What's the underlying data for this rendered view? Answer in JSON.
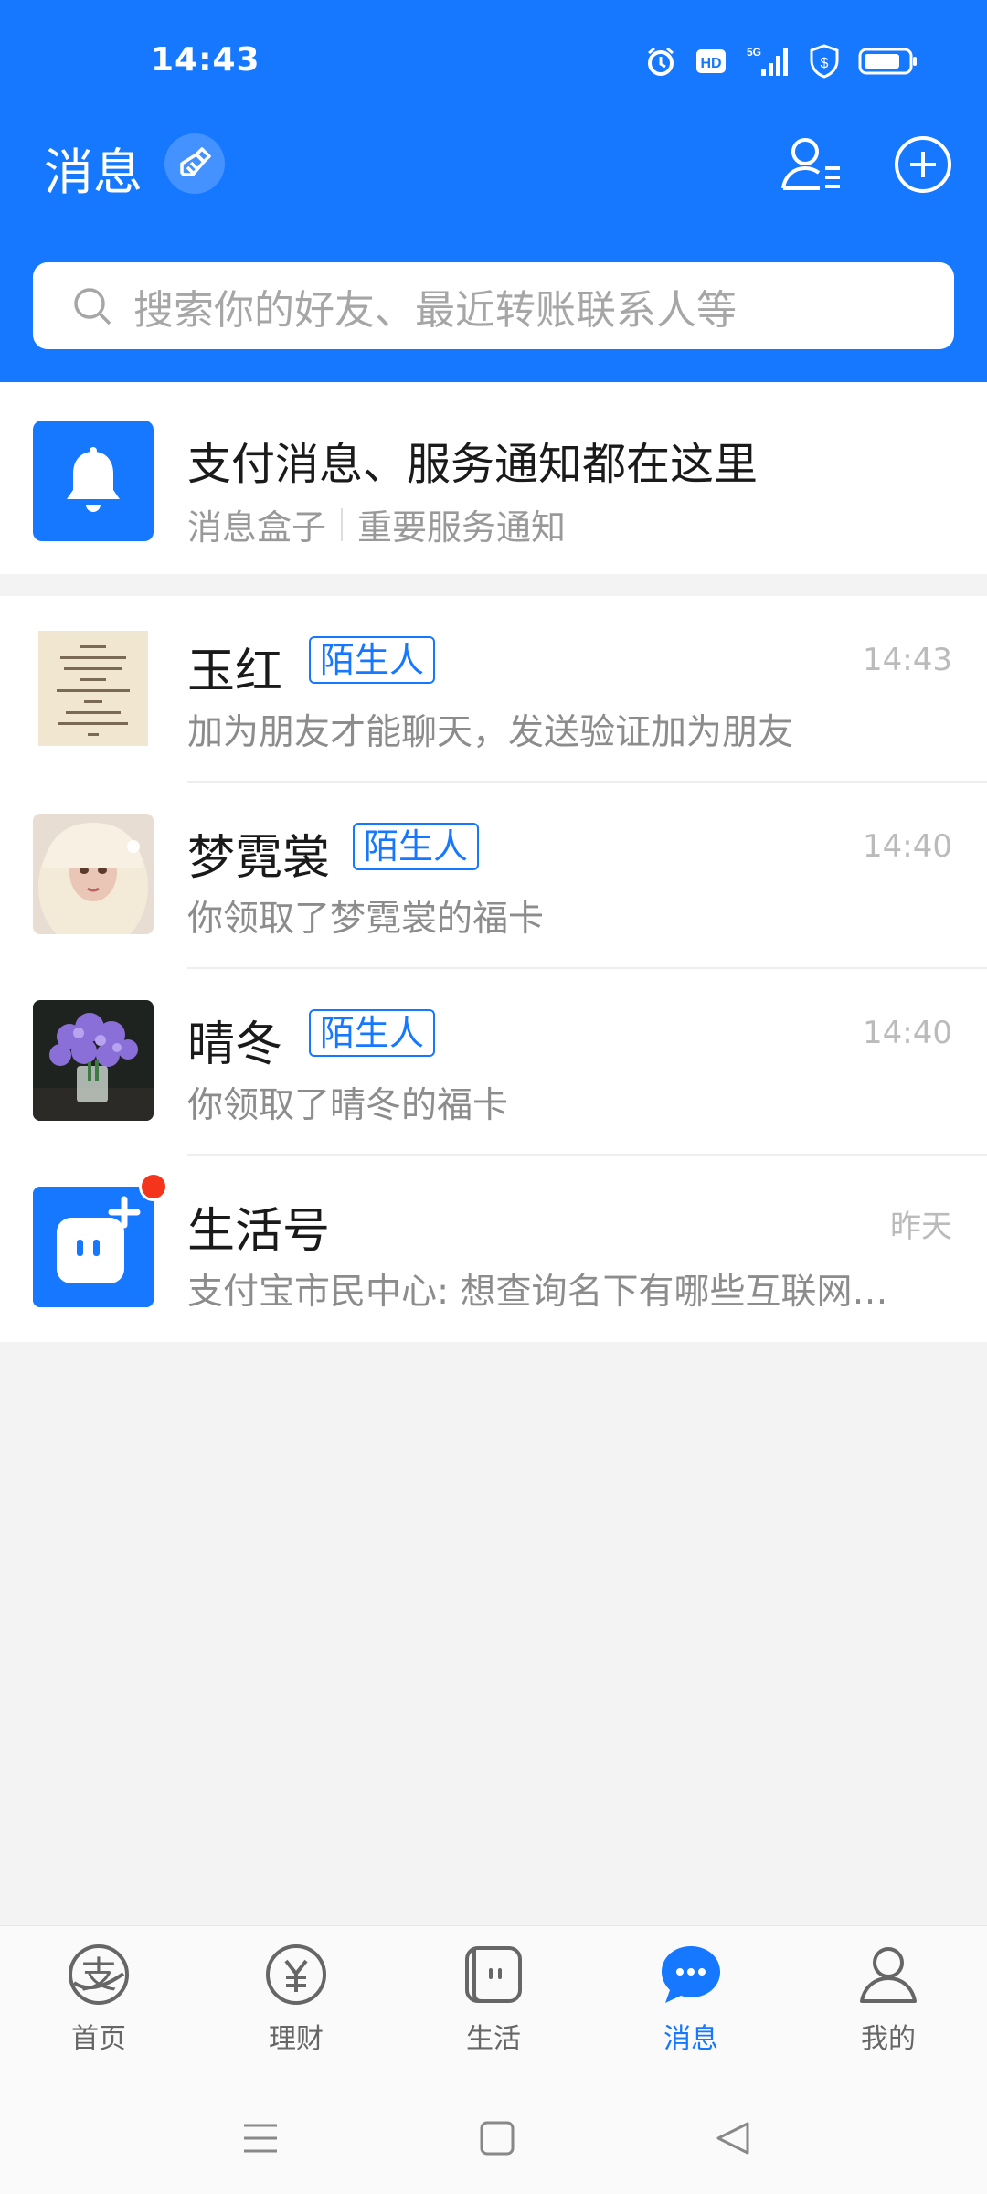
{
  "status_bar": {
    "time": "14:43"
  },
  "header": {
    "title": "消息",
    "search_placeholder": "搜索你的好友、最近转账联系人等"
  },
  "notice": {
    "title": "支付消息、服务通知都在这里",
    "sub_left": "消息盒子",
    "sub_right": "重要服务通知"
  },
  "chats": [
    {
      "name": "玉红",
      "tag": "陌生人",
      "time": "14:43",
      "preview": "加为朋友才能聊天，发送验证加为朋友"
    },
    {
      "name": "梦霓裳",
      "tag": "陌生人",
      "time": "14:40",
      "preview": "你领取了梦霓裳的福卡"
    },
    {
      "name": "晴冬",
      "tag": "陌生人",
      "time": "14:40",
      "preview": "你领取了晴冬的福卡"
    },
    {
      "name": "生活号",
      "tag": "",
      "time": "昨天",
      "preview": "支付宝市民中心: 想查询名下有哪些互联网账..."
    }
  ],
  "tabs": [
    {
      "label": "首页",
      "icon": "alipay-home-icon"
    },
    {
      "label": "理财",
      "icon": "yuan-icon"
    },
    {
      "label": "生活",
      "icon": "life-icon"
    },
    {
      "label": "消息",
      "icon": "message-icon",
      "active": true
    },
    {
      "label": "我的",
      "icon": "user-icon"
    }
  ],
  "colors": {
    "brand": "#1677ff",
    "badge": "#f5341c"
  }
}
